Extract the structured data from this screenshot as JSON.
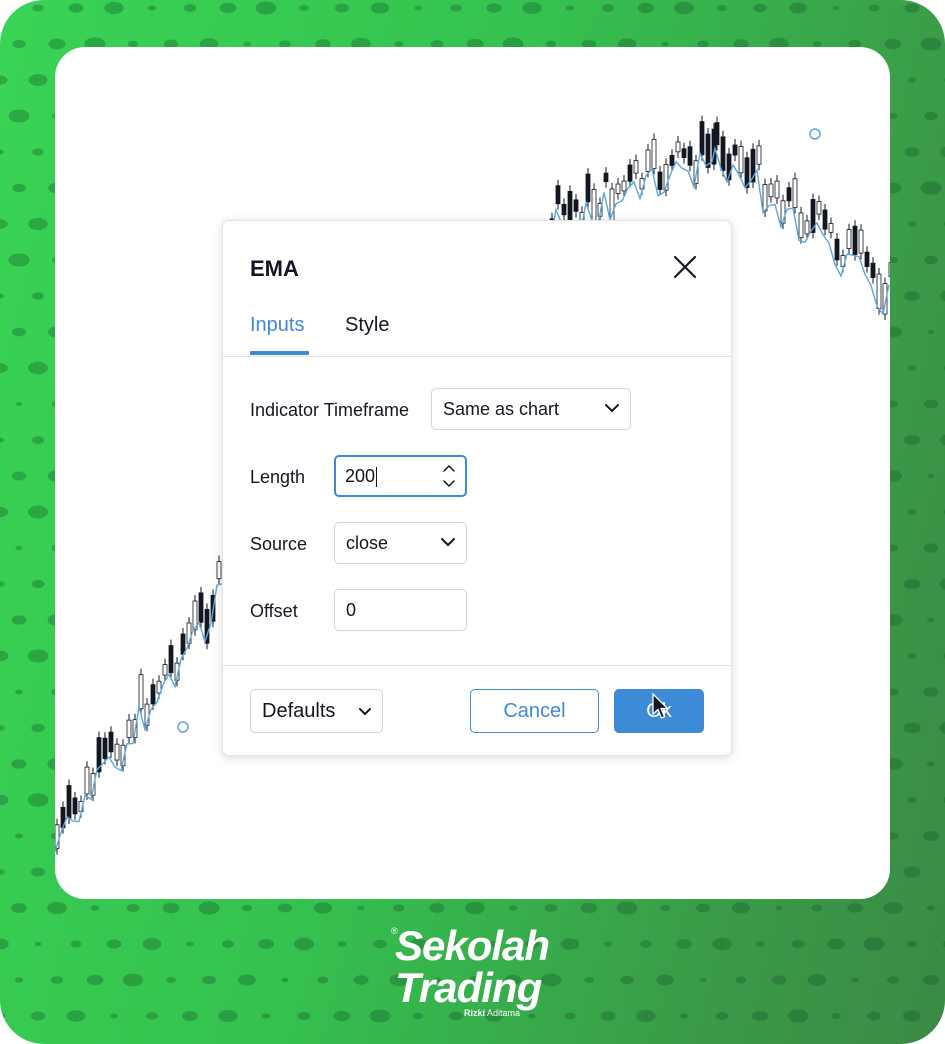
{
  "dialog": {
    "title": "EMA",
    "tabs": [
      {
        "label": "Inputs",
        "active": true
      },
      {
        "label": "Style",
        "active": false
      }
    ],
    "fields": {
      "timeframe": {
        "label": "Indicator Timeframe",
        "value": "Same as chart"
      },
      "length": {
        "label": "Length",
        "value": "200"
      },
      "source": {
        "label": "Source",
        "value": "close"
      },
      "offset": {
        "label": "Offset",
        "value": "0"
      }
    },
    "buttons": {
      "defaults": "Defaults",
      "cancel": "Cancel",
      "ok": "Ok"
    }
  },
  "brand": {
    "line1": "Sekolah",
    "line2": "Trading",
    "registered": "®",
    "subtitle_bold": "Rizki",
    "subtitle": "Aditama"
  },
  "colors": {
    "accent": "#3d8ad6",
    "frame_green": "#39d455",
    "candle": "#131722",
    "ema_line": "#5ea7dc"
  },
  "icons": {
    "close": "close-icon",
    "dropdown": "chevron-down-icon",
    "spinner": "spinner-icon",
    "pointer": "mouse-pointer-icon"
  }
}
